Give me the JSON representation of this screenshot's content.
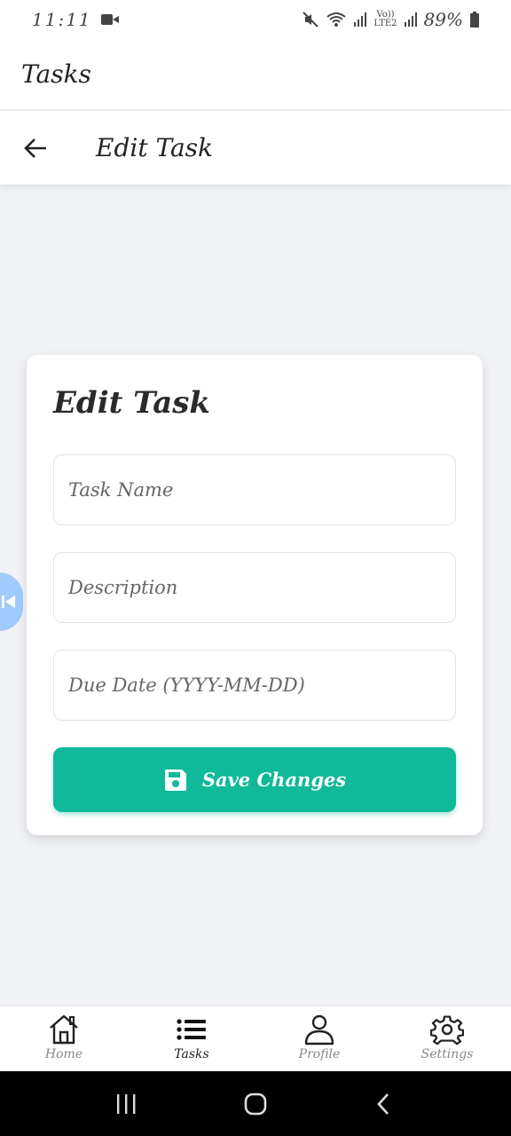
{
  "status_bar": {
    "time": "11:11",
    "network_top": "Vo))",
    "network_bottom": "LTE2",
    "battery": "89%"
  },
  "app_header": {
    "title": "Tasks"
  },
  "sub_header": {
    "title": "Edit Task"
  },
  "card": {
    "title": "Edit Task",
    "task_name_placeholder": "Task Name",
    "description_placeholder": "Description",
    "due_date_placeholder": "Due Date (YYYY-MM-DD)",
    "save_label": "Save Changes"
  },
  "bottom_nav": {
    "items": [
      {
        "label": "Home",
        "icon": "home-icon"
      },
      {
        "label": "Tasks",
        "icon": "list-icon",
        "active": true
      },
      {
        "label": "Profile",
        "icon": "user-icon"
      },
      {
        "label": "Settings",
        "icon": "gear-icon"
      }
    ]
  },
  "colors": {
    "accent": "#10b999",
    "background": "#f0f2f5",
    "side_badge": "#9fcbff"
  }
}
